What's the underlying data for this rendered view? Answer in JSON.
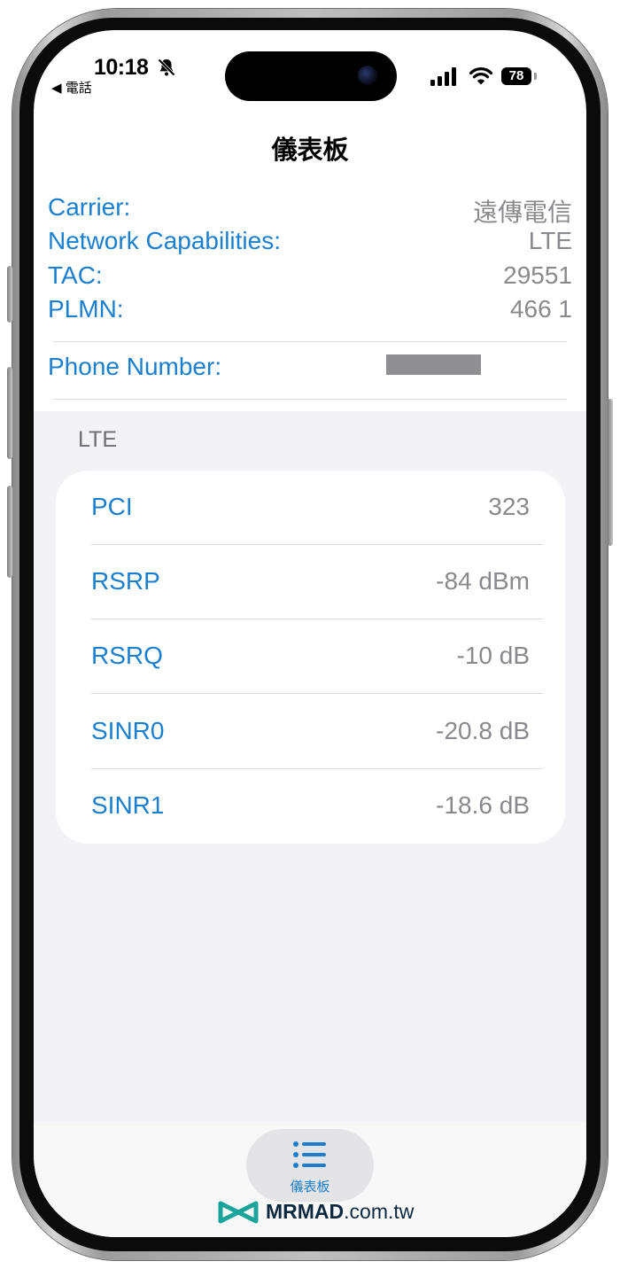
{
  "status_bar": {
    "time": "10:18",
    "back_label": "◀ 電話",
    "battery": "78"
  },
  "nav": {
    "title": "儀表板"
  },
  "carrier_info": [
    {
      "label": "Carrier:",
      "value": "遠傳電信"
    },
    {
      "label": "Network Capabilities:",
      "value": "LTE"
    },
    {
      "label": "TAC:",
      "value": "29551"
    },
    {
      "label": "PLMN:",
      "value": "466 1"
    }
  ],
  "phone_number": {
    "label": "Phone Number:"
  },
  "lte": {
    "header": "LTE",
    "rows": [
      {
        "label": "PCI",
        "value": "323"
      },
      {
        "label": "RSRP",
        "value": "-84 dBm"
      },
      {
        "label": "RSRQ",
        "value": "-10 dB"
      },
      {
        "label": "SINR0",
        "value": "-20.8 dB"
      },
      {
        "label": "SINR1",
        "value": "-18.6 dB"
      }
    ]
  },
  "tab_bar": {
    "items": [
      {
        "label": "儀表板",
        "icon": "list-icon",
        "selected": true
      }
    ]
  },
  "watermark": {
    "brand": "MRMAD",
    "suffix": ".com.tw"
  },
  "colors": {
    "accent": "#1b7fd0",
    "secondary_text": "#8a8a8e",
    "grouped_bg": "#f2f2f7",
    "watermark_logo": "#1aa39a"
  }
}
